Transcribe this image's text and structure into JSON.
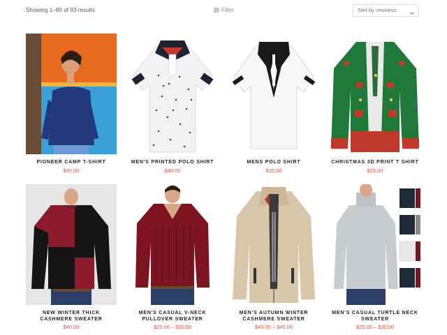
{
  "toolbar": {
    "result_count": "Showing 1–80 of 93 results",
    "filter_label": "Filter",
    "filter_icon": "sliders-icon",
    "sort_selected": "Sort by newness",
    "sort_icon": "chevron-down-icon"
  },
  "colors": {
    "price": "#e74c3c",
    "name": "#222222",
    "border": "#dddddd"
  },
  "products": [
    {
      "name": "PIONEER CAMP T-SHIRT",
      "price": "$40.00"
    },
    {
      "name": "MEN'S PRINTED POLO SHIRT",
      "price": "$40.00"
    },
    {
      "name": "MENS POLO SHIRT",
      "price": "$25.00"
    },
    {
      "name": "CHRISTMAS 3D PRINT T SHIRT",
      "price": "$25.00"
    },
    {
      "name_line1": "NEW WINTER THICK",
      "name_line2": "CASHMERE SWEATER",
      "price": "$40.00"
    },
    {
      "name_line1": "MEN'S CASUAL V-NECK",
      "name_line2": "PULLOVER SWEATER",
      "price": "$25.00 – $30.00"
    },
    {
      "name_line1": "MEN'S AUTUMN WINTER",
      "name_line2": "CASHMERE SWEATER",
      "price": "$40.00 – $45.00"
    },
    {
      "name_line1": "MEN'S CASUAL TURTLE NECK",
      "name_line2": "SWEATER",
      "price": "$25.00 – $30.00"
    }
  ]
}
